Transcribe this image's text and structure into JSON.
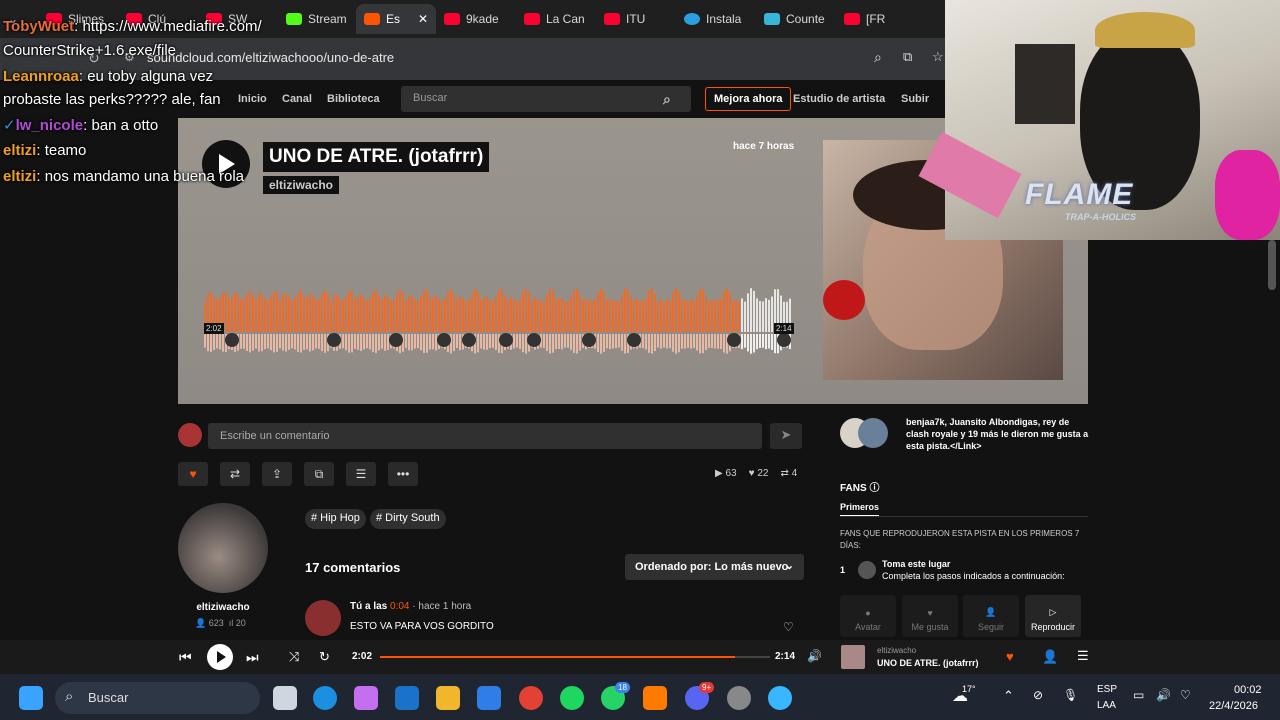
{
  "tabs": [
    {
      "label": "Slimes"
    },
    {
      "label": "Clú"
    },
    {
      "label": "SW"
    },
    {
      "label": "Stream"
    },
    {
      "label": "Es"
    },
    {
      "label": "9kade"
    },
    {
      "label": "La Can"
    },
    {
      "label": "ITU"
    },
    {
      "label": "Instala"
    },
    {
      "label": "Counte"
    },
    {
      "label": "[FR"
    }
  ],
  "address": {
    "url": "soundcloud.com/eltiziwachooo/uno-de-atre"
  },
  "nav": {
    "items": [
      "Inicio",
      "Canal",
      "Biblioteca"
    ],
    "search_placeholder": "Buscar",
    "upgrade": "Mejora ahora",
    "studio": "Estudio de artista",
    "upload": "Subir"
  },
  "track": {
    "title": "UNO DE ATRE. (jotafrrr)",
    "artist": "eltiziwacho",
    "posted": "hace 7 horas",
    "elapsed": "2:02",
    "duration": "2:14",
    "progress_fraction": 0.91
  },
  "chat": [
    {
      "user": "TobyWuet",
      "msg": "https://www.mediafire.com/"
    },
    {
      "user": "",
      "msg": "CounterStrike+1.6.exe/file"
    },
    {
      "user": "Leannroaa",
      "msg": "eu toby alguna vez"
    },
    {
      "user": "",
      "msg": "probaste las perks????? ale, fan"
    },
    {
      "user": "lw_nicole",
      "msg": "ban a otto"
    },
    {
      "user": "eltizi",
      "msg": "teamo"
    },
    {
      "user": "eltizi",
      "msg": "nos mandamo una buena rola"
    }
  ],
  "overlay": {
    "flame": "FLAME",
    "flame_sub": "TRAP-A-HOLICS"
  },
  "comment": {
    "placeholder": "Escribe un comentario"
  },
  "stats": {
    "plays": "63",
    "likes": "22",
    "reposts": "4"
  },
  "tags": [
    "# Hip Hop",
    "# Dirty South"
  ],
  "uploader": {
    "name": "eltiziwacho",
    "followers": "623",
    "tracks": "20"
  },
  "comments": {
    "count_label": "17 comentarios",
    "sort_label": "Ordenado por: Lo más nuevo",
    "first": {
      "who": "Tú a las",
      "time": "0:04",
      "ago": "· hace 1 hora",
      "text": "ESTO VA PARA VOS GORDITO"
    }
  },
  "likes_info": "benjaa7k, Juansito Albondigas, rey de clash royale y 19 más le dieron me gusta a esta pista.</Link>",
  "fans": {
    "title": "FANS",
    "tab": "Primeros",
    "desc": "FANS QUE REPRODUJERON ESTA PISTA EN LOS PRIMEROS 7 DÍAS:",
    "rank": "1",
    "place_title": "Toma este lugar",
    "place_desc": "Completa los pasos indicados a continuación:",
    "actions": [
      "Avatar",
      "Me gusta",
      "Seguir",
      "Reproducir"
    ]
  },
  "player": {
    "artist": "eltiziwacho",
    "title": "UNO DE ATRE. (jotafrrr)"
  },
  "taskbar": {
    "search": "Buscar",
    "temp": "17°",
    "lang1": "ESP",
    "lang2": "LAA",
    "time": "00:02",
    "date": "22/4/2026",
    "badge1": "18",
    "badge2": "9+"
  },
  "colors": {
    "accent": "#ff5500",
    "wave": "#f06a28"
  }
}
